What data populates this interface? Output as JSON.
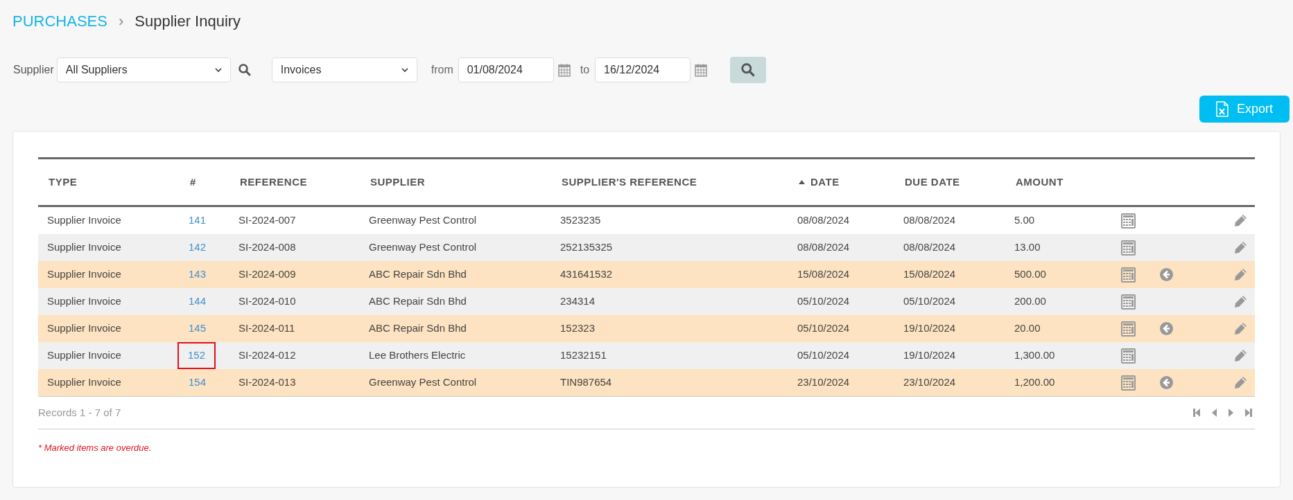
{
  "breadcrumb": {
    "section": "PURCHASES",
    "separator": "›",
    "page": "Supplier Inquiry"
  },
  "filters": {
    "supplier_label": "Supplier",
    "supplier": "All Suppliers",
    "document_type": "Invoices",
    "from_label": "from",
    "from": "01/08/2024",
    "to_label": "to",
    "to": "16/12/2024"
  },
  "export_button": "Export",
  "table": {
    "columns": [
      {
        "label": "TYPE",
        "sorted": false
      },
      {
        "label": "#",
        "sorted": false
      },
      {
        "label": "REFERENCE",
        "sorted": false
      },
      {
        "label": "SUPPLIER",
        "sorted": false
      },
      {
        "label": "SUPPLIER'S REFERENCE",
        "sorted": false
      },
      {
        "label": "DATE",
        "sorted": true
      },
      {
        "label": "DUE DATE",
        "sorted": false
      },
      {
        "label": "AMOUNT",
        "sorted": false
      }
    ],
    "rows": [
      {
        "type": "Supplier Invoice",
        "number": "141",
        "reference": "SI-2024-007",
        "supplier": "Greenway Pest Control",
        "supplier_reference": "3523235",
        "date": "08/08/2024",
        "due_date": "08/08/2024",
        "amount": "5.00",
        "overdue": false,
        "highlighted": false
      },
      {
        "type": "Supplier Invoice",
        "number": "142",
        "reference": "SI-2024-008",
        "supplier": "Greenway Pest Control",
        "supplier_reference": "252135325",
        "date": "08/08/2024",
        "due_date": "08/08/2024",
        "amount": "13.00",
        "overdue": false,
        "highlighted": false
      },
      {
        "type": "Supplier Invoice",
        "number": "143",
        "reference": "SI-2024-009",
        "supplier": "ABC Repair Sdn Bhd",
        "supplier_reference": "431641532",
        "date": "15/08/2024",
        "due_date": "15/08/2024",
        "amount": "500.00",
        "overdue": true,
        "highlighted": false
      },
      {
        "type": "Supplier Invoice",
        "number": "144",
        "reference": "SI-2024-010",
        "supplier": "ABC Repair Sdn Bhd",
        "supplier_reference": "234314",
        "date": "05/10/2024",
        "due_date": "05/10/2024",
        "amount": "200.00",
        "overdue": false,
        "highlighted": false
      },
      {
        "type": "Supplier Invoice",
        "number": "145",
        "reference": "SI-2024-011",
        "supplier": "ABC Repair Sdn Bhd",
        "supplier_reference": "152323",
        "date": "05/10/2024",
        "due_date": "19/10/2024",
        "amount": "20.00",
        "overdue": true,
        "highlighted": false
      },
      {
        "type": "Supplier Invoice",
        "number": "152",
        "reference": "SI-2024-012",
        "supplier": "Lee Brothers Electric",
        "supplier_reference": "15232151",
        "date": "05/10/2024",
        "due_date": "19/10/2024",
        "amount": "1,300.00",
        "overdue": false,
        "highlighted": true
      },
      {
        "type": "Supplier Invoice",
        "number": "154",
        "reference": "SI-2024-013",
        "supplier": "Greenway Pest Control",
        "supplier_reference": "TIN987654",
        "date": "23/10/2024",
        "due_date": "23/10/2024",
        "amount": "1,200.00",
        "overdue": true,
        "highlighted": false
      }
    ]
  },
  "records": "Records 1 - 7 of 7",
  "note": "* Marked items are overdue."
}
